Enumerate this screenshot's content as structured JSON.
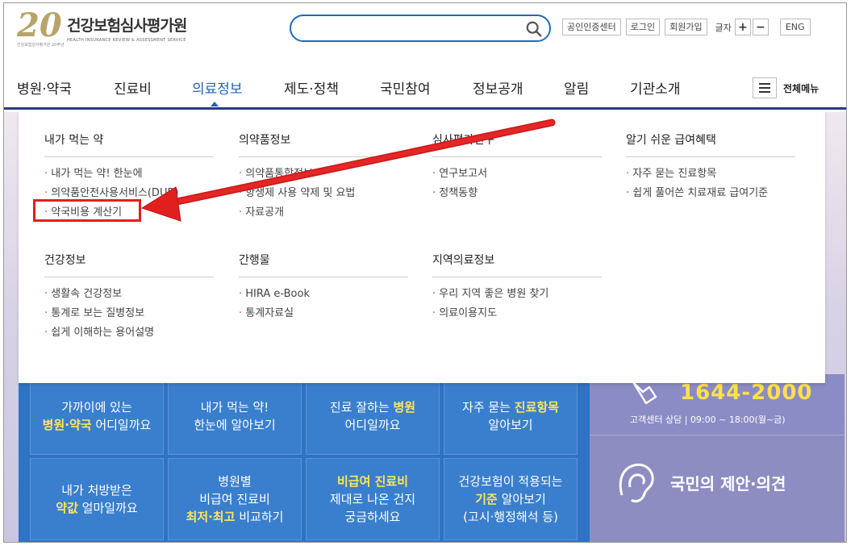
{
  "header": {
    "logo_number": "20",
    "logo_sub": "건강보험심사평가원 20주년",
    "logo_title": "건강보험심사평가원",
    "logo_subtitle": "HEALTH INSURANCE REVIEW & ASSESSMENT SERVICE",
    "search_placeholder": "",
    "util": {
      "cert": "공인인증센터",
      "login": "로그인",
      "join": "회원가입",
      "font_label": "글자",
      "plus": "+",
      "minus": "−",
      "eng": "ENG"
    }
  },
  "nav": {
    "items": [
      "병원·약국",
      "진료비",
      "의료정보",
      "제도·정책",
      "국민참여",
      "정보공개",
      "알림",
      "기관소개"
    ],
    "active": "의료정보",
    "all_menu": "전체메뉴"
  },
  "mega_menu": {
    "columns": [
      {
        "title": "내가 먹는 약",
        "items": [
          "내가 먹는 약! 한눈에",
          "의약품안전사용서비스(DUR)",
          "약국비용 계산기"
        ]
      },
      {
        "title": "의약품정보",
        "items": [
          "의약품통합정보",
          "항생제 사용 약제 및 요법",
          "자료공개"
        ]
      },
      {
        "title": "심사평가연구",
        "items": [
          "연구보고서",
          "정책동향"
        ]
      },
      {
        "title": "알기 쉬운 급여혜택",
        "items": [
          "자주 묻는 진료항목",
          "쉽게 풀어쓴 치료재료 급여기준"
        ]
      },
      {
        "title": "건강정보",
        "items": [
          "생활속 건강정보",
          "통계로 보는 질병정보",
          "쉽게 이해하는 용어설명"
        ]
      },
      {
        "title": "간행물",
        "items": [
          "HIRA e-Book",
          "통계자료실"
        ]
      },
      {
        "title": "지역의료정보",
        "items": [
          "우리 지역 좋은 병원 찾기",
          "의료이용지도"
        ]
      }
    ]
  },
  "quick": {
    "cells": [
      {
        "line1": "가까이에 있는",
        "hl": "병원·약국",
        "line2": " 어디일까요"
      },
      {
        "line1": "내가 먹는 약!",
        "hl": "",
        "line2": "한눈에 알아보기"
      },
      {
        "line1": "진료 잘하는 ",
        "hl": "병원",
        "line2": "어디일까요"
      },
      {
        "line1": "자주 묻는 ",
        "hl": "진료항목",
        "line2": "알아보기"
      },
      {
        "line1": "내가 처방받은",
        "hl": "약값",
        "line2": " 얼마일까요"
      },
      {
        "line1": "병원별",
        "line_mid": "비급여 진료비",
        "hl": "최저·최고",
        "line2": " 비교하기"
      },
      {
        "hl": "비급여 진료비",
        "line1": "제대로 나온 건지",
        "line2": "궁금하세요"
      },
      {
        "line1": "건강보험이 적용되는",
        "hl": "기준",
        "line2": " 알아보기",
        "line3": "(고시·행정해석 등)"
      }
    ]
  },
  "customer_center": {
    "phone": "1644-2000",
    "hours": "고객센터 상담  | 09:00 ~ 18:00(월~금)",
    "opinion": "국민의 제안·의견"
  },
  "annotation": {
    "highlight_color": "#e21f1f"
  }
}
